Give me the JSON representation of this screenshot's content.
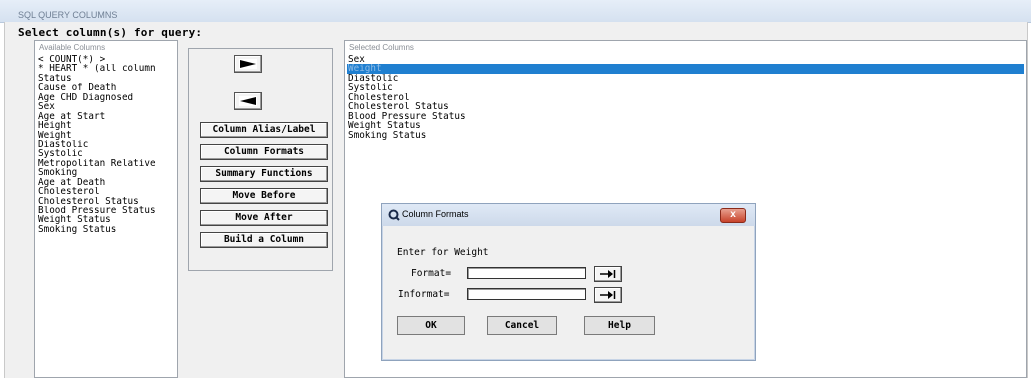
{
  "window": {
    "title": "SQL QUERY COLUMNS"
  },
  "prompt": "Select column(s) for query:",
  "available": {
    "label": "Available Columns",
    "items": [
      "< COUNT(*) >",
      "* HEART * (all column",
      "Status",
      "Cause of Death",
      "Age CHD Diagnosed",
      "Sex",
      "Age at Start",
      "Height",
      "Weight",
      "Diastolic",
      "Systolic",
      "Metropolitan Relative",
      "Smoking",
      "Age at Death",
      "Cholesterol",
      "Cholesterol Status",
      "Blood Pressure Status",
      "Weight Status",
      "Smoking Status"
    ]
  },
  "buttons": {
    "add_icon": "right-arrow-icon",
    "remove_icon": "left-arrow-icon",
    "column_alias": "Column Alias/Label",
    "column_formats": "Column Formats",
    "summary_functions": "Summary Functions",
    "move_before": "Move Before",
    "move_after": "Move After",
    "build_column": "Build a Column"
  },
  "selected": {
    "label": "Selected Columns",
    "items": [
      "Sex",
      "Weight",
      "Diastolic",
      "Systolic",
      "Cholesterol",
      "Cholesterol Status",
      "Blood Pressure Status",
      "Weight Status",
      "Smoking Status"
    ],
    "selected_index": 1
  },
  "dialog": {
    "title": "Column Formats",
    "close_label": "x",
    "heading": "Enter for Weight",
    "format_label": "Format=",
    "format_value": "",
    "informat_label": "Informat=",
    "informat_value": "",
    "ok": "OK",
    "cancel": "Cancel",
    "help": "Help"
  },
  "colors": {
    "selection": "#1f7fd0",
    "close_button": "#c7422a"
  }
}
